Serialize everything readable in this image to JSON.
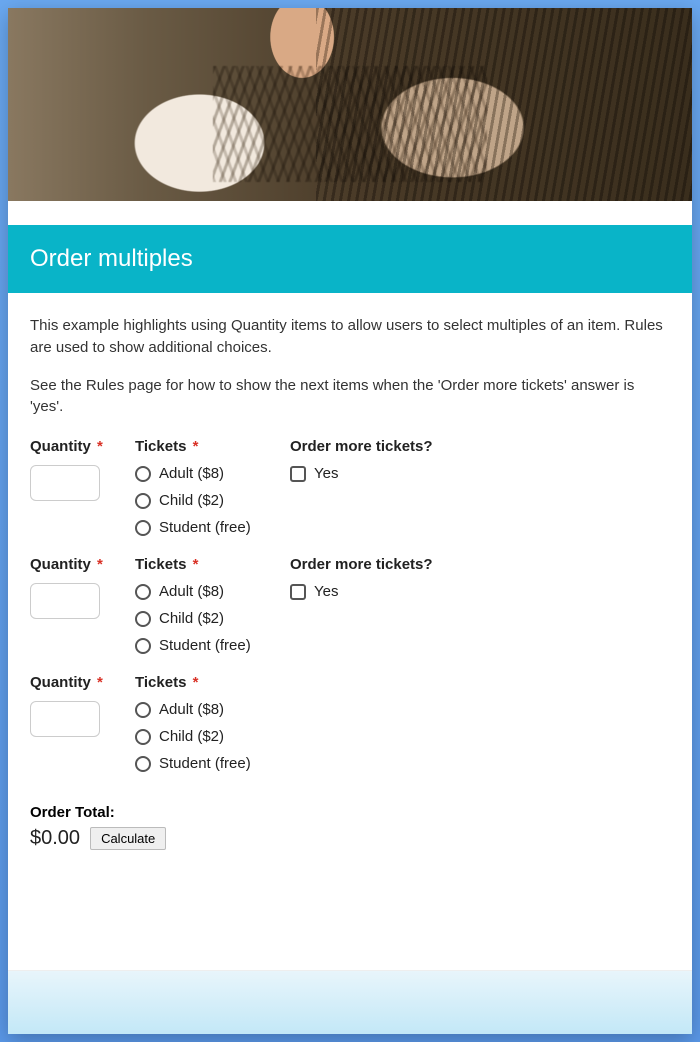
{
  "title": "Order multiples",
  "intro_p1": "This example highlights using Quantity items to allow users to select multiples of an item. Rules are used to show additional choices.",
  "intro_p2": "See the Rules page for how to show the next items when the 'Order more tickets' answer is 'yes'.",
  "labels": {
    "quantity": "Quantity",
    "tickets": "Tickets",
    "order_more": "Order more tickets?",
    "required_mark": "*"
  },
  "ticket_options": {
    "adult": "Adult ($8)",
    "child": "Child ($2)",
    "student": "Student (free)"
  },
  "order_more_option": "Yes",
  "rows": [
    {
      "show_order_more": true
    },
    {
      "show_order_more": true
    },
    {
      "show_order_more": false
    }
  ],
  "order_total": {
    "label": "Order Total:",
    "value": "$0.00",
    "calculate": "Calculate"
  }
}
